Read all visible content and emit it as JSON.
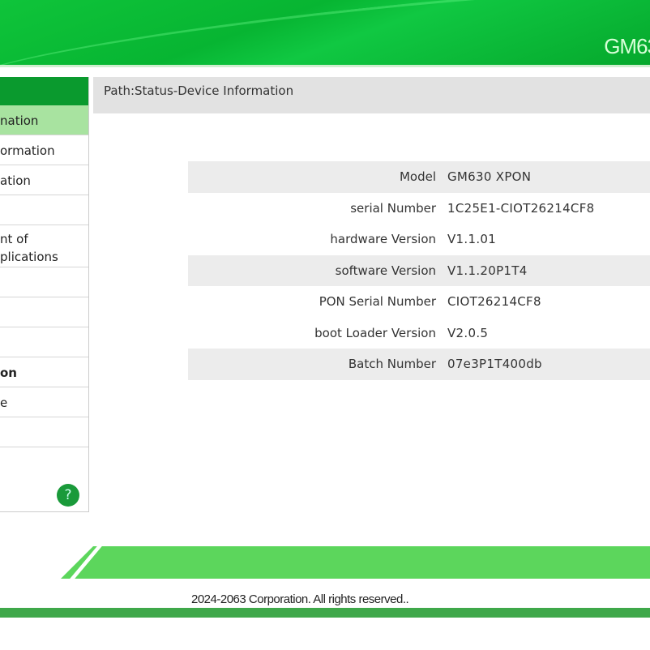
{
  "header": {
    "title": "GM63"
  },
  "sidebar": {
    "items": [
      {
        "label": "nation",
        "active": true
      },
      {
        "label": "ormation"
      },
      {
        "label": "ation"
      },
      {
        "label": ""
      },
      {
        "label": "nt of",
        "label2": "plications"
      },
      {
        "label": ""
      },
      {
        "label": ""
      },
      {
        "label": ""
      },
      {
        "label": "on"
      },
      {
        "label": "e"
      },
      {
        "label": ""
      }
    ],
    "help": "?"
  },
  "path": "Path:Status-Device Information",
  "device_info": [
    {
      "key": "Model",
      "value": "GM630 XPON"
    },
    {
      "key": "serial Number",
      "value": "1C25E1-CIOT26214CF8"
    },
    {
      "key": "hardware Version",
      "value": "V1.1.01"
    },
    {
      "key": "software Version",
      "value": "V1.1.20P1T4"
    },
    {
      "key": "PON Serial Number",
      "value": "CIOT26214CF8"
    },
    {
      "key": "boot Loader Version",
      "value": "V2.0.5"
    },
    {
      "key": "Batch Number",
      "value": "07e3P1T400db"
    }
  ],
  "footer": {
    "copyright": "2024-2063 Corporation. All rights reserved.."
  }
}
